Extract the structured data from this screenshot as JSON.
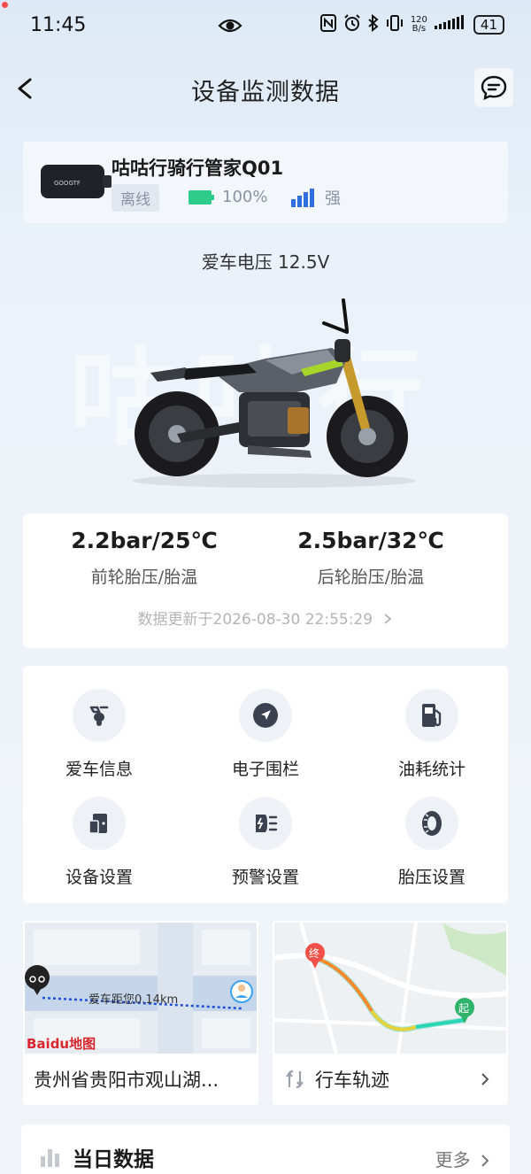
{
  "status_bar": {
    "time": "11:45",
    "net_speed_value": "120",
    "net_speed_unit": "B/s",
    "battery": "41"
  },
  "nav": {
    "title": "设备监测数据"
  },
  "device": {
    "name": "咕咕行骑行管家Q01",
    "status": "离线",
    "battery": "100%",
    "signal": "强",
    "chip_label": "GOOGTF"
  },
  "vehicle": {
    "voltage_text": "爱车电压 12.5V",
    "watermark": "咕咕行"
  },
  "tire": {
    "front_value": "2.2bar/25℃",
    "front_label": "前轮胎压/胎温",
    "rear_value": "2.5bar/32℃",
    "rear_label": "后轮胎压/胎温",
    "updated": "数据更新于2026-08-30 22:55:29"
  },
  "functions": [
    {
      "label": "爱车信息",
      "icon": "scooter-icon"
    },
    {
      "label": "电子围栏",
      "icon": "location-arrow-icon"
    },
    {
      "label": "油耗统计",
      "icon": "fuel-pump-icon"
    },
    {
      "label": "设备设置",
      "icon": "device-icon"
    },
    {
      "label": "预警设置",
      "icon": "headlight-icon"
    },
    {
      "label": "胎压设置",
      "icon": "tire-icon"
    }
  ],
  "location_card": {
    "distance_text": "爱车距您0.14km",
    "map_brand": "Baidu地图",
    "address": "贵州省贵阳市观山湖..."
  },
  "track_card": {
    "label": "行车轨迹",
    "end_marker": "终",
    "start_marker": "起"
  },
  "daily": {
    "title": "当日数据",
    "more": "更多"
  },
  "colors": {
    "accent_blue": "#2f6fe0",
    "battery_green": "#2ecc8a",
    "icon_dark": "#3c4150"
  }
}
